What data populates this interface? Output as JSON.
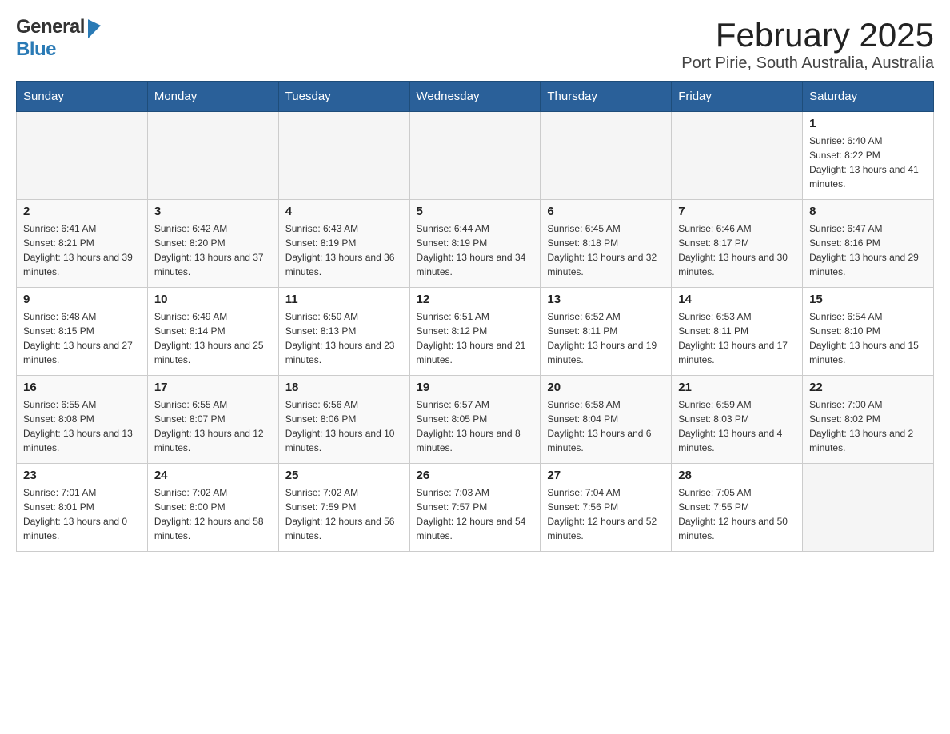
{
  "header": {
    "logo_general": "General",
    "logo_blue": "Blue",
    "title": "February 2025",
    "subtitle": "Port Pirie, South Australia, Australia"
  },
  "calendar": {
    "days_of_week": [
      "Sunday",
      "Monday",
      "Tuesday",
      "Wednesday",
      "Thursday",
      "Friday",
      "Saturday"
    ],
    "weeks": [
      [
        {
          "day": "",
          "info": ""
        },
        {
          "day": "",
          "info": ""
        },
        {
          "day": "",
          "info": ""
        },
        {
          "day": "",
          "info": ""
        },
        {
          "day": "",
          "info": ""
        },
        {
          "day": "",
          "info": ""
        },
        {
          "day": "1",
          "info": "Sunrise: 6:40 AM\nSunset: 8:22 PM\nDaylight: 13 hours and 41 minutes."
        }
      ],
      [
        {
          "day": "2",
          "info": "Sunrise: 6:41 AM\nSunset: 8:21 PM\nDaylight: 13 hours and 39 minutes."
        },
        {
          "day": "3",
          "info": "Sunrise: 6:42 AM\nSunset: 8:20 PM\nDaylight: 13 hours and 37 minutes."
        },
        {
          "day": "4",
          "info": "Sunrise: 6:43 AM\nSunset: 8:19 PM\nDaylight: 13 hours and 36 minutes."
        },
        {
          "day": "5",
          "info": "Sunrise: 6:44 AM\nSunset: 8:19 PM\nDaylight: 13 hours and 34 minutes."
        },
        {
          "day": "6",
          "info": "Sunrise: 6:45 AM\nSunset: 8:18 PM\nDaylight: 13 hours and 32 minutes."
        },
        {
          "day": "7",
          "info": "Sunrise: 6:46 AM\nSunset: 8:17 PM\nDaylight: 13 hours and 30 minutes."
        },
        {
          "day": "8",
          "info": "Sunrise: 6:47 AM\nSunset: 8:16 PM\nDaylight: 13 hours and 29 minutes."
        }
      ],
      [
        {
          "day": "9",
          "info": "Sunrise: 6:48 AM\nSunset: 8:15 PM\nDaylight: 13 hours and 27 minutes."
        },
        {
          "day": "10",
          "info": "Sunrise: 6:49 AM\nSunset: 8:14 PM\nDaylight: 13 hours and 25 minutes."
        },
        {
          "day": "11",
          "info": "Sunrise: 6:50 AM\nSunset: 8:13 PM\nDaylight: 13 hours and 23 minutes."
        },
        {
          "day": "12",
          "info": "Sunrise: 6:51 AM\nSunset: 8:12 PM\nDaylight: 13 hours and 21 minutes."
        },
        {
          "day": "13",
          "info": "Sunrise: 6:52 AM\nSunset: 8:11 PM\nDaylight: 13 hours and 19 minutes."
        },
        {
          "day": "14",
          "info": "Sunrise: 6:53 AM\nSunset: 8:11 PM\nDaylight: 13 hours and 17 minutes."
        },
        {
          "day": "15",
          "info": "Sunrise: 6:54 AM\nSunset: 8:10 PM\nDaylight: 13 hours and 15 minutes."
        }
      ],
      [
        {
          "day": "16",
          "info": "Sunrise: 6:55 AM\nSunset: 8:08 PM\nDaylight: 13 hours and 13 minutes."
        },
        {
          "day": "17",
          "info": "Sunrise: 6:55 AM\nSunset: 8:07 PM\nDaylight: 13 hours and 12 minutes."
        },
        {
          "day": "18",
          "info": "Sunrise: 6:56 AM\nSunset: 8:06 PM\nDaylight: 13 hours and 10 minutes."
        },
        {
          "day": "19",
          "info": "Sunrise: 6:57 AM\nSunset: 8:05 PM\nDaylight: 13 hours and 8 minutes."
        },
        {
          "day": "20",
          "info": "Sunrise: 6:58 AM\nSunset: 8:04 PM\nDaylight: 13 hours and 6 minutes."
        },
        {
          "day": "21",
          "info": "Sunrise: 6:59 AM\nSunset: 8:03 PM\nDaylight: 13 hours and 4 minutes."
        },
        {
          "day": "22",
          "info": "Sunrise: 7:00 AM\nSunset: 8:02 PM\nDaylight: 13 hours and 2 minutes."
        }
      ],
      [
        {
          "day": "23",
          "info": "Sunrise: 7:01 AM\nSunset: 8:01 PM\nDaylight: 13 hours and 0 minutes."
        },
        {
          "day": "24",
          "info": "Sunrise: 7:02 AM\nSunset: 8:00 PM\nDaylight: 12 hours and 58 minutes."
        },
        {
          "day": "25",
          "info": "Sunrise: 7:02 AM\nSunset: 7:59 PM\nDaylight: 12 hours and 56 minutes."
        },
        {
          "day": "26",
          "info": "Sunrise: 7:03 AM\nSunset: 7:57 PM\nDaylight: 12 hours and 54 minutes."
        },
        {
          "day": "27",
          "info": "Sunrise: 7:04 AM\nSunset: 7:56 PM\nDaylight: 12 hours and 52 minutes."
        },
        {
          "day": "28",
          "info": "Sunrise: 7:05 AM\nSunset: 7:55 PM\nDaylight: 12 hours and 50 minutes."
        },
        {
          "day": "",
          "info": ""
        }
      ]
    ]
  }
}
